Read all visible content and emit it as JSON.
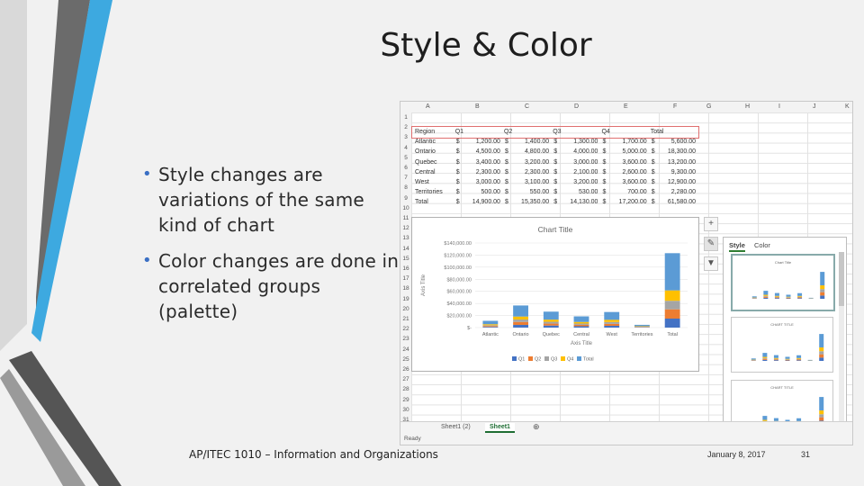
{
  "slide": {
    "title": "Style & Color",
    "bullets": [
      "Style changes are variations of the same kind of chart",
      "Color changes are done in correlated groups (palette)"
    ],
    "footer": "AP/ITEC 1010 – Information and Organizations",
    "date": "January 8, 2017",
    "page": "31"
  },
  "excel": {
    "columns": [
      "A",
      "B",
      "C",
      "D",
      "E",
      "F",
      "G",
      "H",
      "I",
      "J",
      "K"
    ],
    "rows": [
      "1",
      "2",
      "3",
      "4",
      "5",
      "6",
      "7",
      "8",
      "9",
      "10",
      "11",
      "12",
      "13",
      "14",
      "15",
      "16",
      "17",
      "18",
      "19",
      "20",
      "21",
      "22",
      "23",
      "24",
      "25",
      "26",
      "27",
      "28",
      "29",
      "30",
      "31",
      "32"
    ],
    "table": {
      "headers": [
        "Region",
        "Q1",
        "Q2",
        "Q3",
        "Q4",
        "Total"
      ],
      "currency": "$",
      "rows": [
        {
          "region": "Atlantic",
          "q1": "1,200.00",
          "q2": "1,400.00",
          "q3": "1,300.00",
          "q4": "1,700.00",
          "total": "5,600.00"
        },
        {
          "region": "Ontario",
          "q1": "4,500.00",
          "q2": "4,800.00",
          "q3": "4,000.00",
          "q4": "5,000.00",
          "total": "18,300.00"
        },
        {
          "region": "Quebec",
          "q1": "3,400.00",
          "q2": "3,200.00",
          "q3": "3,000.00",
          "q4": "3,600.00",
          "total": "13,200.00"
        },
        {
          "region": "Central",
          "q1": "2,300.00",
          "q2": "2,300.00",
          "q3": "2,100.00",
          "q4": "2,600.00",
          "total": "9,300.00"
        },
        {
          "region": "West",
          "q1": "3,000.00",
          "q2": "3,100.00",
          "q3": "3,200.00",
          "q4": "3,600.00",
          "total": "12,900.00"
        },
        {
          "region": "Territories",
          "q1": "500.00",
          "q2": "550.00",
          "q3": "530.00",
          "q4": "700.00",
          "total": "2,280.00"
        },
        {
          "region": "Total",
          "q1": "14,900.00",
          "q2": "15,350.00",
          "q3": "14,130.00",
          "q4": "17,200.00",
          "total": "61,580.00"
        }
      ]
    },
    "sheets": [
      "Sheet1 (2)",
      "Sheet1"
    ],
    "active_sheet": "Sheet1",
    "status": "Ready",
    "side_buttons": [
      "plus-icon",
      "brush-icon",
      "filter-icon"
    ],
    "pane_tabs": [
      "Style",
      "Color"
    ],
    "pane_thumb_titles": [
      "Chart Title",
      "CHART TITLE",
      "CHART TITLE"
    ]
  },
  "chart_data": {
    "type": "bar",
    "title": "Chart Title",
    "xlabel": "Axis Title",
    "ylabel": "Axis Title",
    "categories": [
      "Atlantic",
      "Ontario",
      "Quebec",
      "Central",
      "West",
      "Territories",
      "Total"
    ],
    "ylim": [
      0,
      140000
    ],
    "yticks": [
      "$-",
      "$20,000.00",
      "$40,000.00",
      "$60,000.00",
      "$80,000.00",
      "$100,000.00",
      "$120,000.00",
      "$140,000.00"
    ],
    "stacked": true,
    "series": [
      {
        "name": "Q1",
        "color": "#4472c4",
        "values": [
          1200,
          4500,
          3400,
          2300,
          3000,
          500,
          14900
        ]
      },
      {
        "name": "Q2",
        "color": "#ed7d31",
        "values": [
          1400,
          4800,
          3200,
          2300,
          3100,
          550,
          15350
        ]
      },
      {
        "name": "Q3",
        "color": "#a5a5a5",
        "values": [
          1300,
          4000,
          3000,
          2100,
          3200,
          530,
          14130
        ]
      },
      {
        "name": "Q4",
        "color": "#ffc000",
        "values": [
          1700,
          5000,
          3600,
          2600,
          3600,
          700,
          17200
        ]
      },
      {
        "name": "Total",
        "color": "#5b9bd5",
        "values": [
          5600,
          18300,
          13200,
          9300,
          12900,
          2280,
          61580
        ]
      }
    ],
    "legend": "bottom",
    "grid": true
  }
}
